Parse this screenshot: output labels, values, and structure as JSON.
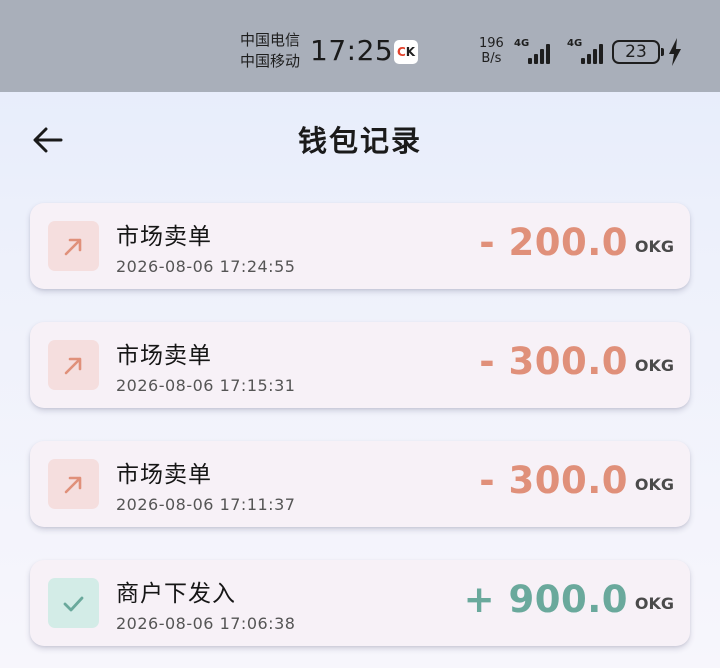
{
  "status_bar": {
    "carrier_1": "中国电信",
    "carrier_2": "中国移动",
    "time": "17:25",
    "app_icon": "ck-icon",
    "net_speed_value": "196",
    "net_speed_unit": "B/s",
    "signal_1_label": "4G",
    "signal_2_label": "4G",
    "battery_level": "23",
    "charging_icon": "bolt-icon"
  },
  "header": {
    "back_icon": "arrow-left-icon",
    "title": "钱包记录"
  },
  "colors": {
    "outgoing_amount": "#e0907a",
    "outgoing_icon_bg": "#f5dede",
    "incoming_amount": "#6aa99c",
    "incoming_icon_bg": "#d3ece7"
  },
  "records": [
    {
      "icon": "arrow-up-right-icon",
      "title": "市场卖单",
      "time": "2026-08-06 17:24:55",
      "amount": "- 200.0",
      "unit": "OKG",
      "direction": "out"
    },
    {
      "icon": "arrow-up-right-icon",
      "title": "市场卖单",
      "time": "2026-08-06 17:15:31",
      "amount": "- 300.0",
      "unit": "OKG",
      "direction": "out"
    },
    {
      "icon": "arrow-up-right-icon",
      "title": "市场卖单",
      "time": "2026-08-06 17:11:37",
      "amount": "- 300.0",
      "unit": "OKG",
      "direction": "out"
    },
    {
      "icon": "check-icon",
      "title": "商户下发入",
      "time": "2026-08-06 17:06:38",
      "amount": "+ 900.0",
      "unit": "OKG",
      "direction": "in"
    }
  ]
}
